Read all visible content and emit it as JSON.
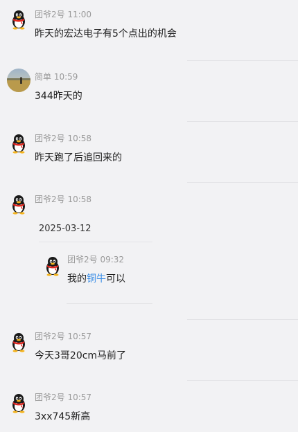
{
  "messages": [
    {
      "sender": "团爷2号",
      "time": "11:00",
      "text": "昨天的宏达电子有5个点出的机会",
      "avatar": "penguin-avatar"
    },
    {
      "sender": "简单",
      "time": "10:59",
      "text": "344昨天的",
      "avatar": "landscape-photo-avatar"
    },
    {
      "sender": "团爷2号",
      "time": "10:58",
      "text": "昨天跑了后追回来的",
      "avatar": "penguin-avatar"
    },
    {
      "sender": "团爷2号",
      "time": "10:58",
      "text": "",
      "avatar": "penguin-avatar"
    },
    {
      "sender": "团爷2号",
      "time": "10:57",
      "text": "今天3哥20cm马前了",
      "avatar": "penguin-avatar"
    },
    {
      "sender": "团爷2号",
      "time": "10:57",
      "text": "3xx745新高",
      "avatar": "penguin-avatar"
    }
  ],
  "quote": {
    "date": "2025-03-12",
    "sender": "团爷2号",
    "time": "09:32",
    "text_before": "我的",
    "keyword": "铜牛",
    "text_after": "可以",
    "avatar": "penguin-avatar"
  },
  "colors": {
    "background": "#f2f2f4",
    "keyword": "#3b8ee6",
    "meta": "#9a9a9a"
  }
}
